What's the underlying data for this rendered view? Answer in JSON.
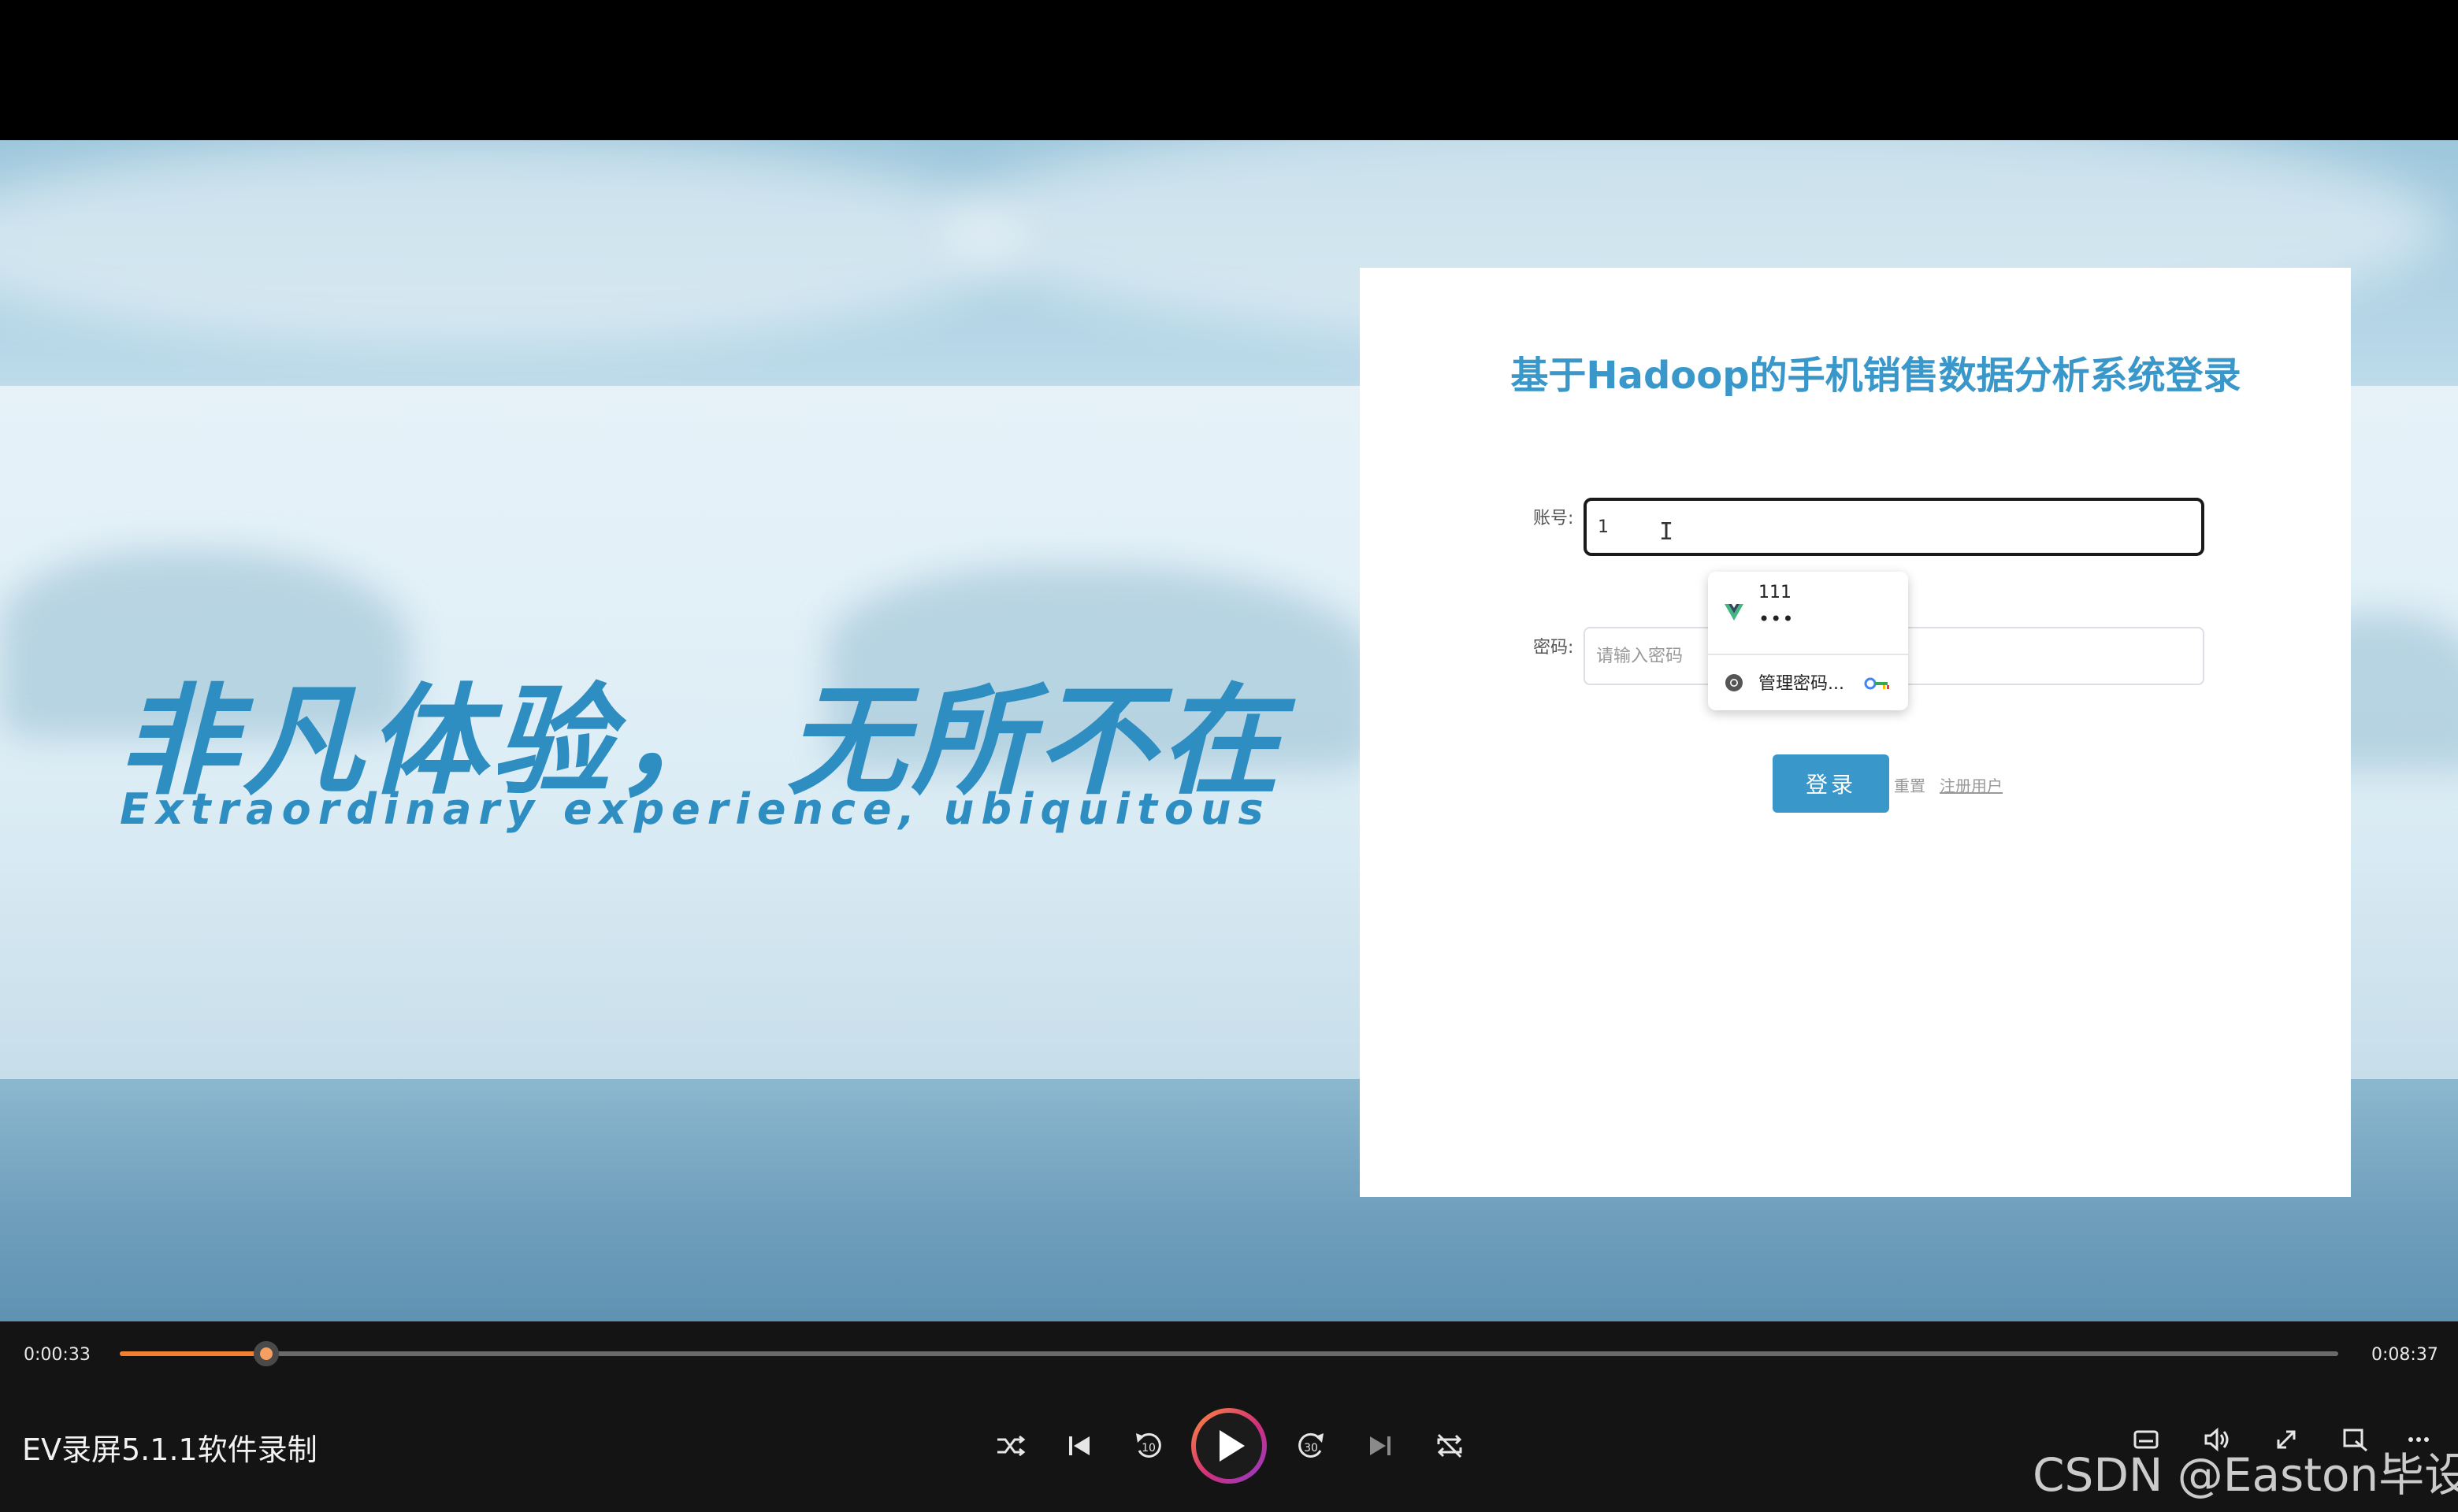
{
  "video": {
    "slogan_cn": "非凡体验， 无所不在",
    "slogan_en": "Extraordinary experience, ubiquitous"
  },
  "login": {
    "title": "基于Hadoop的手机销售数据分析系统登录",
    "account_label": "账号:",
    "account_value": "1",
    "password_label": "密码:",
    "password_placeholder": "请输入密码",
    "submit_label": "登录",
    "reset_label": "重置",
    "register_label": "注册用户"
  },
  "autocomplete": {
    "saved_user": "111",
    "saved_password_mask": "•••",
    "manage_label": "管理密码..."
  },
  "player": {
    "current_time": "0:00:33",
    "total_time": "0:08:37",
    "progress": 0.066,
    "media_title": "EV录屏5.1.1软件录制",
    "skip_back_seconds": "10",
    "skip_forward_seconds": "30"
  },
  "watermark": "CSDN @Easton毕设",
  "colors": {
    "accent_blue": "#3a97c9",
    "progress_orange": "#f08030"
  },
  "icons": [
    "shuffle-icon",
    "previous-icon",
    "rewind-10-icon",
    "play-icon",
    "forward-30-icon",
    "next-icon",
    "repeat-off-icon",
    "subtitles-icon",
    "volume-icon",
    "fullscreen-icon",
    "mini-player-icon",
    "more-icon",
    "vue-logo-icon",
    "chrome-icon",
    "key-icon"
  ]
}
